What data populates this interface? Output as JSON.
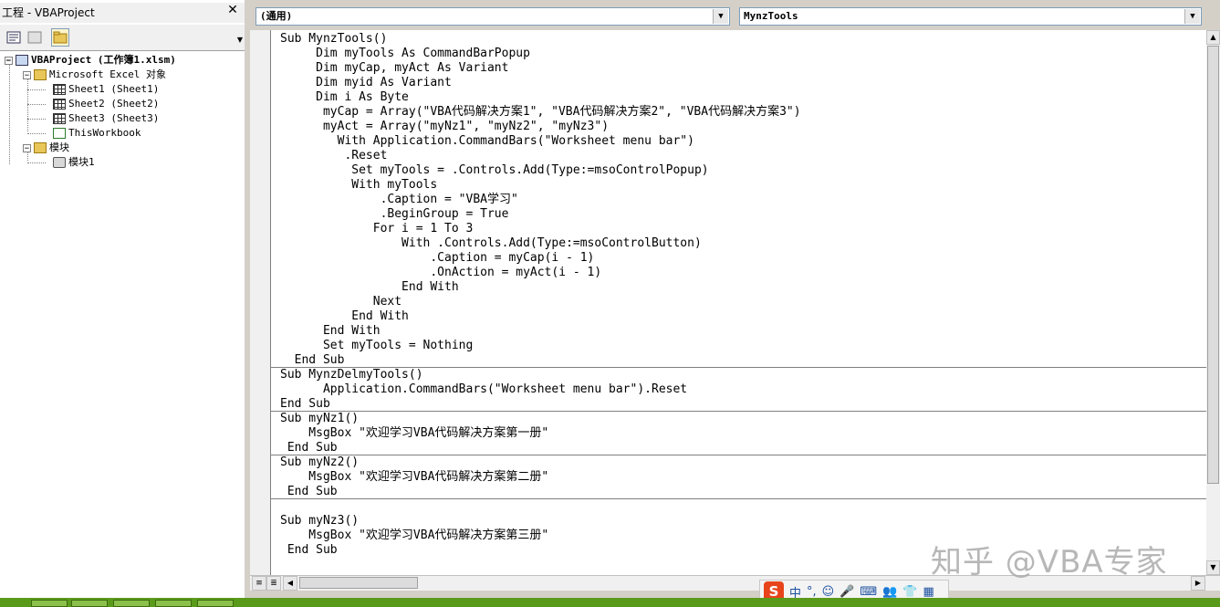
{
  "project_panel": {
    "title": "工程 - VBAProject",
    "close_glyph": "✕",
    "tree": {
      "project": "VBAProject (工作簿1.xlsm)",
      "excel_objects": "Microsoft Excel 对象",
      "sheet1": "Sheet1 (Sheet1)",
      "sheet2": "Sheet2 (Sheet2)",
      "sheet3": "Sheet3 (Sheet3)",
      "thisworkbook": "ThisWorkbook",
      "modules": "模块",
      "module1": "模块1"
    }
  },
  "code_window": {
    "object_combo": "(通用)",
    "procedure_combo": "MynzTools",
    "lines": [
      "Sub MynzTools()",
      "     Dim myTools As CommandBarPopup",
      "     Dim myCap, myAct As Variant",
      "     Dim myid As Variant",
      "     Dim i As Byte",
      "      myCap = Array(\"VBA代码解决方案1\", \"VBA代码解决方案2\", \"VBA代码解决方案3\")",
      "      myAct = Array(\"myNz1\", \"myNz2\", \"myNz3\")",
      "        With Application.CommandBars(\"Worksheet menu bar\")",
      "         .Reset",
      "          Set myTools = .Controls.Add(Type:=msoControlPopup)",
      "          With myTools",
      "              .Caption = \"VBA学习\"",
      "              .BeginGroup = True",
      "             For i = 1 To 3",
      "                 With .Controls.Add(Type:=msoControlButton)",
      "                     .Caption = myCap(i - 1)",
      "                     .OnAction = myAct(i - 1)",
      "                 End With",
      "             Next",
      "          End With",
      "      End With",
      "      Set myTools = Nothing",
      "  End Sub",
      "Sub MynzDelmyTools()",
      "      Application.CommandBars(\"Worksheet menu bar\").Reset",
      "End Sub",
      "Sub myNz1()",
      "    MsgBox \"欢迎学习VBA代码解决方案第一册\"",
      " End Sub",
      "Sub myNz2()",
      "    MsgBox \"欢迎学习VBA代码解决方案第二册\"",
      " End Sub",
      "",
      "Sub myNz3()",
      "    MsgBox \"欢迎学习VBA代码解决方案第三册\"",
      " End Sub"
    ]
  },
  "ime": {
    "logo": "S",
    "items": [
      "中",
      "°,",
      "☺",
      "🎤",
      "⌨",
      "👥",
      "👕",
      "▦"
    ]
  },
  "watermark": "知乎 @VBA专家",
  "icons": {
    "dropdown": "▼",
    "up": "▲",
    "down": "▼",
    "left": "◀",
    "right": "▶",
    "expand": "−"
  }
}
